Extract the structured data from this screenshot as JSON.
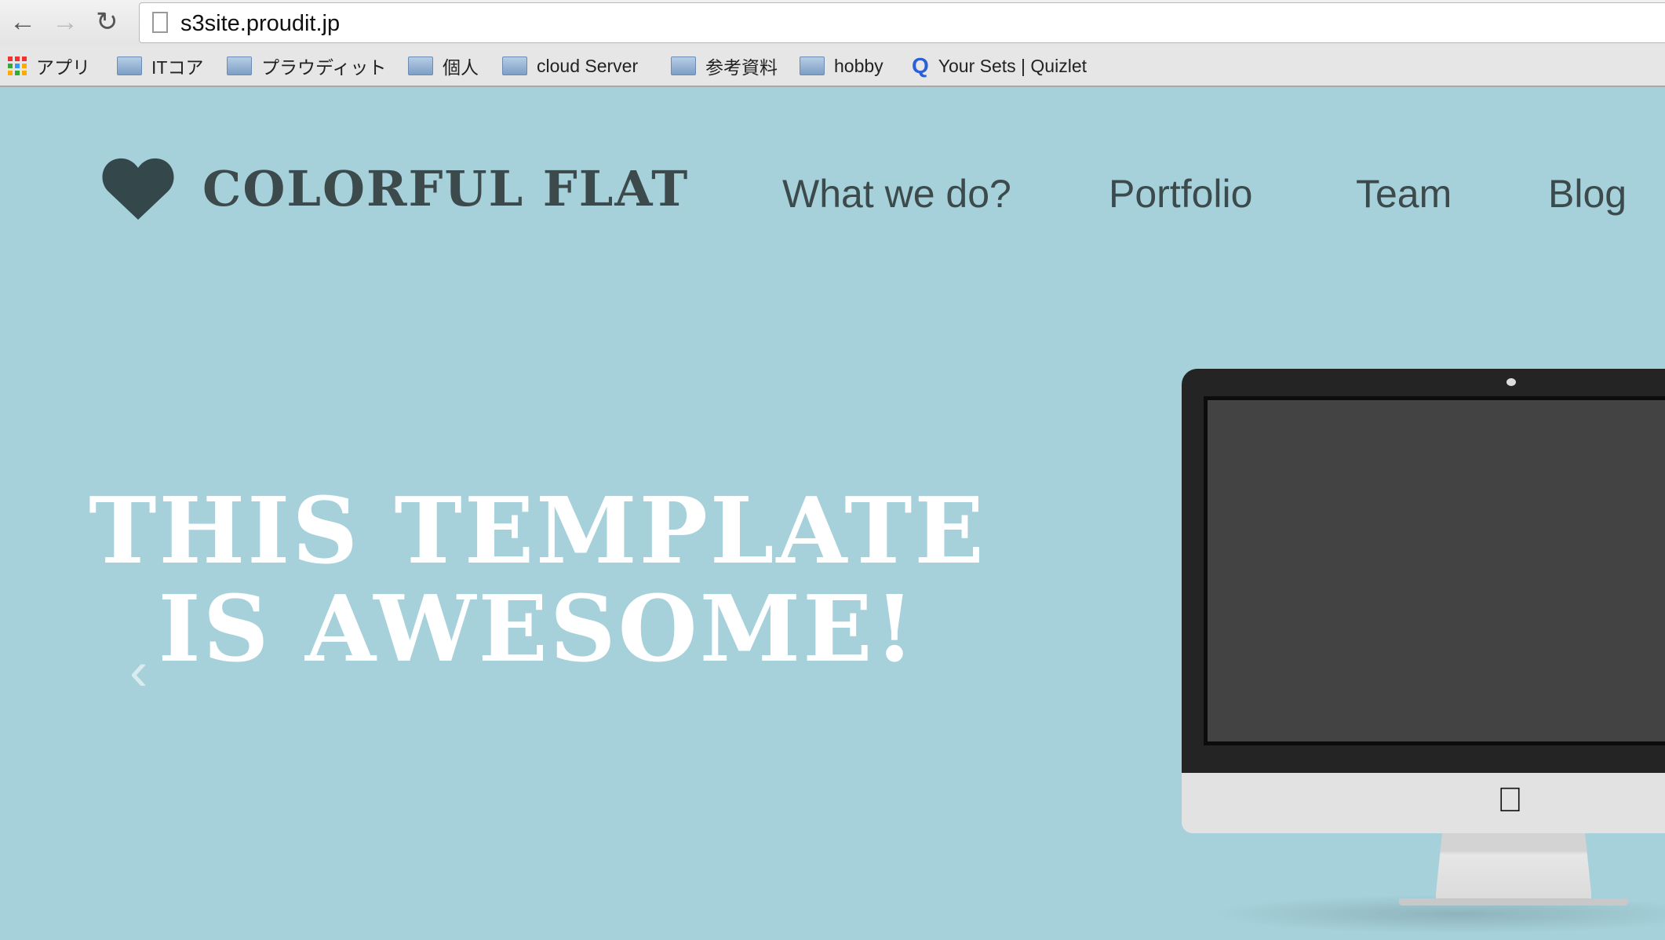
{
  "browser": {
    "url": "s3site.proudit.jp",
    "bookmarks": [
      {
        "label": "アプリ",
        "icon": "apps-grid-icon"
      },
      {
        "label": "ITコア",
        "icon": "folder-icon"
      },
      {
        "label": "プラウディット",
        "icon": "folder-icon"
      },
      {
        "label": "個人",
        "icon": "folder-icon"
      },
      {
        "label": "cloud Server",
        "icon": "folder-icon"
      },
      {
        "label": "参考資料",
        "icon": "folder-icon"
      },
      {
        "label": "hobby",
        "icon": "folder-icon"
      },
      {
        "label": "Your Sets | Quizlet",
        "icon": "quizlet-icon"
      }
    ]
  },
  "site": {
    "logo": "COLORFUL FLAT",
    "nav": [
      "What we do?",
      "Portfolio",
      "Team",
      "Blog"
    ],
    "hero": {
      "line1": "THIS TEMPLATE",
      "line2": "IS AWESOME!"
    },
    "colors": {
      "background": "#a6d1da",
      "text": "#3c4a4c"
    }
  }
}
